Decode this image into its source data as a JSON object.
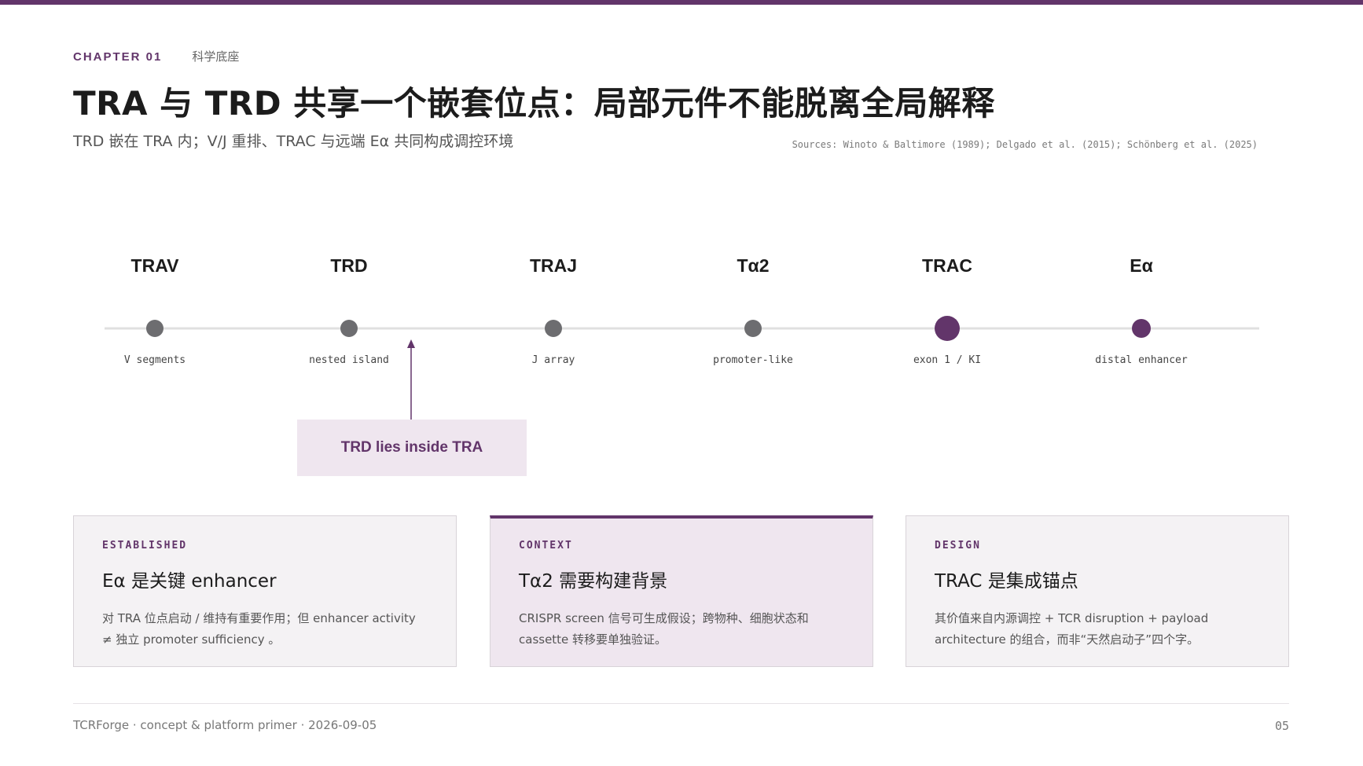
{
  "colors": {
    "accent": "#62356a",
    "node_gray": "#6d6d70",
    "track": "#e0e0e0",
    "callout_bg": "#efe6ef"
  },
  "header": {
    "chapter_label": "CHAPTER 01",
    "chapter_sub": "科学底座",
    "title": "TRA 与 TRD 共享一个嵌套位点：局部元件不能脱离全局解释",
    "subtitle": "TRD 嵌在 TRA 内；V/J 重排、TRAC 与远端 Eα 共同构成调控环境",
    "sources": "Sources: Winoto & Baltimore (1989); Delgado et al. (2015); Schönberg et al. (2025)"
  },
  "timeline": {
    "nodes": [
      {
        "label": "TRAV",
        "caption": "V segments",
        "style": "gray"
      },
      {
        "label": "TRD",
        "caption": "nested island",
        "style": "gray"
      },
      {
        "label": "TRAJ",
        "caption": "J array",
        "style": "gray"
      },
      {
        "label": "Tα2",
        "caption": "promoter-like",
        "style": "gray"
      },
      {
        "label": "TRAC",
        "caption": "exon 1 / KI",
        "style": "accent-large"
      },
      {
        "label": "Eα",
        "caption": "distal enhancer",
        "style": "accent"
      }
    ],
    "callout": "TRD lies inside TRA"
  },
  "cards": [
    {
      "tag": "ESTABLISHED",
      "title": "Eα 是关键 enhancer",
      "body": "对 TRA 位点启动 / 维持有重要作用；但 enhancer activity ≠ 独立 promoter sufficiency 。"
    },
    {
      "tag": "CONTEXT",
      "title": "Tα2 需要构建背景",
      "body": "CRISPR screen 信号可生成假设；跨物种、细胞状态和 cassette 转移要单独验证。"
    },
    {
      "tag": "DESIGN",
      "title": "TRAC 是集成锚点",
      "body": "其价值来自内源调控 + TCR disruption + payload architecture 的组合，而非“天然启动子”四个字。"
    }
  ],
  "footer": {
    "left": "TCRForge · concept & platform primer · 2026-09-05",
    "page": "05"
  }
}
